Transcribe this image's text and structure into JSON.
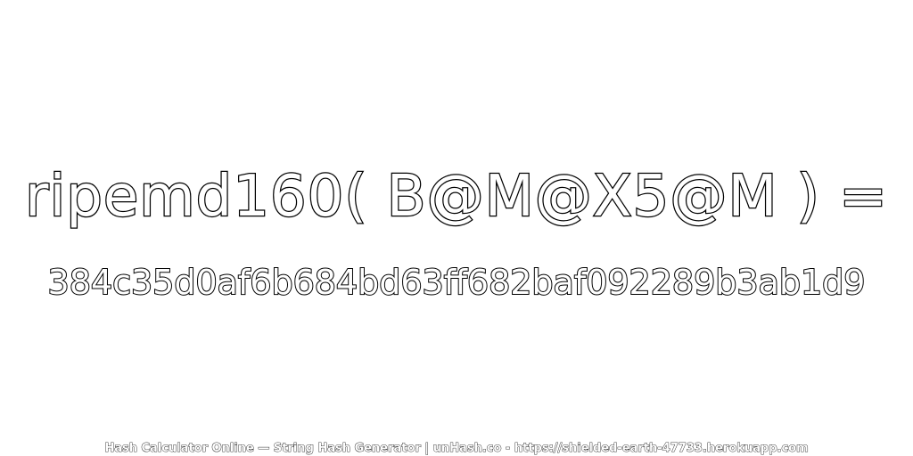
{
  "main": {
    "expression": "ripemd160( B@M@X5@M ) =",
    "hash_value": "384c35d0af6b684bd63ff682baf092289b3ab1d9"
  },
  "footer": {
    "text": "Hash Calculator Online — String Hash Generator | unHash.co - https://shielded-earth-47733.herokuapp.com"
  },
  "colors": {
    "background": "#ffffff",
    "text_fill": "#ffffff",
    "text_outline": "#000000"
  }
}
